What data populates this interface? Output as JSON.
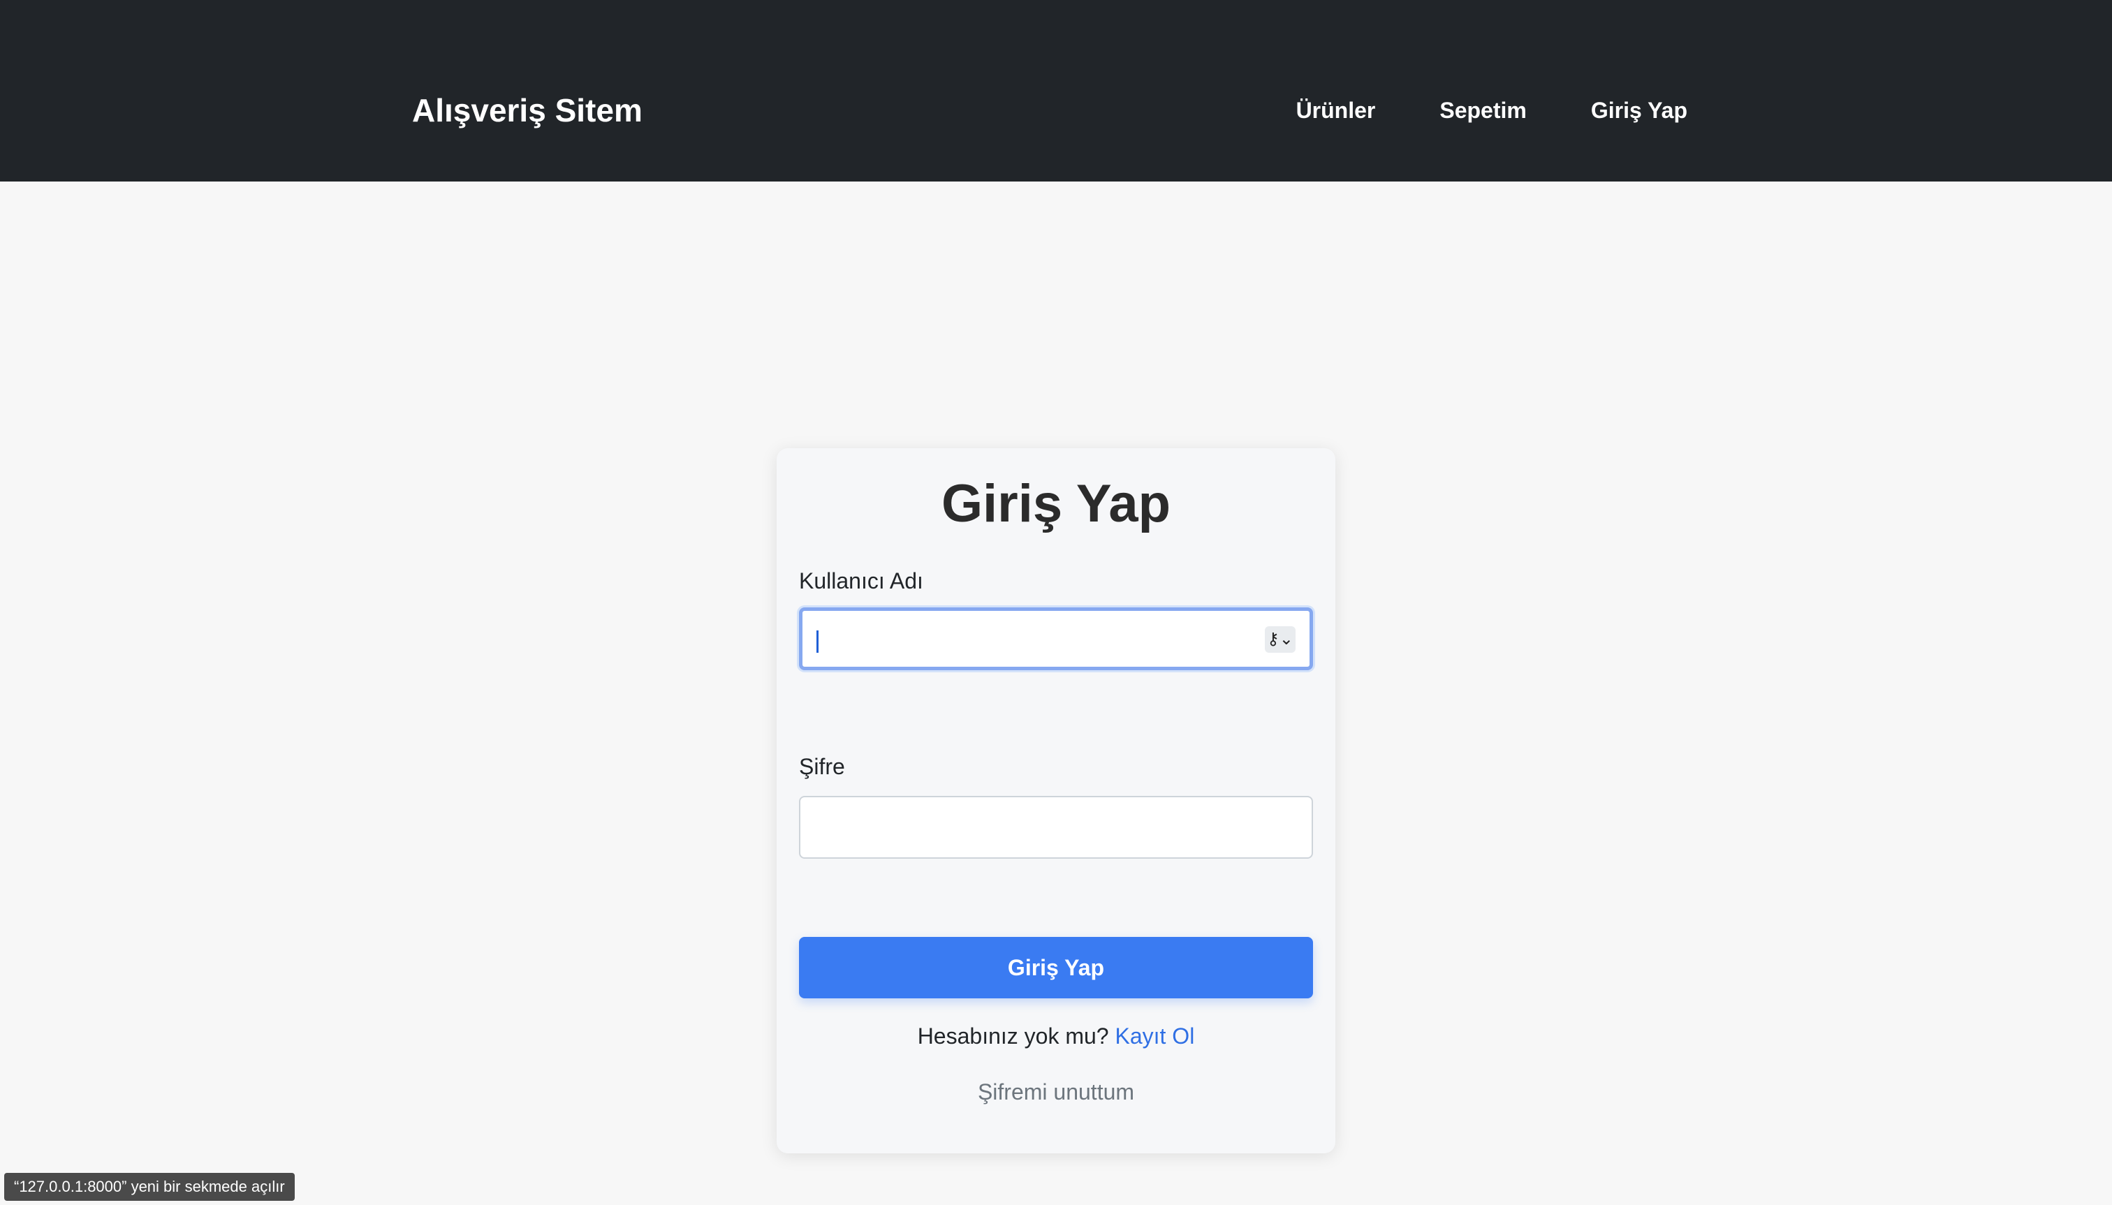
{
  "navbar": {
    "brand": "Alışveriş Sitem",
    "links": [
      {
        "label": "Ürünler"
      },
      {
        "label": "Sepetim"
      },
      {
        "label": "Giriş Yap"
      }
    ]
  },
  "login": {
    "title": "Giriş Yap",
    "username_label": "Kullanıcı Adı",
    "username_value": "",
    "password_label": "Şifre",
    "password_value": "",
    "submit_label": "Giriş Yap",
    "signup_prompt": "Hesabınız yok mu?",
    "signup_link": "Kayıt Ol",
    "forgot_link": "Şifremi unuttum"
  },
  "status_tooltip": "“127.0.0.1:8000” yeni bir sekmede açılır",
  "colors": {
    "navbar_bg": "#212529",
    "primary": "#3a7bf2",
    "link": "#2f6fe4",
    "page_bg": "#f7f7f7"
  },
  "icons": {
    "password_manager": "key-icon"
  }
}
